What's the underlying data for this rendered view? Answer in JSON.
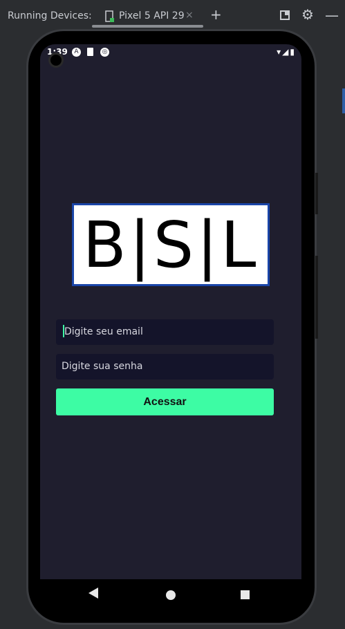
{
  "toolbar": {
    "title": "Running Devices:",
    "tab_label": "Pixel 5 API 29",
    "tab_close": "×",
    "add": "+"
  },
  "status_bar": {
    "time": "1:39",
    "right_icons": "▾◢▮"
  },
  "logo": {
    "text": "B|S|L"
  },
  "form": {
    "email_placeholder": "Digite seu email",
    "password_placeholder": "Digite sua senha",
    "submit_label": "Acessar"
  },
  "colors": {
    "accent": "#3dfca4",
    "screen_bg": "#1f1e2e",
    "field_bg": "#14142a",
    "logo_border": "#1a45a8"
  }
}
